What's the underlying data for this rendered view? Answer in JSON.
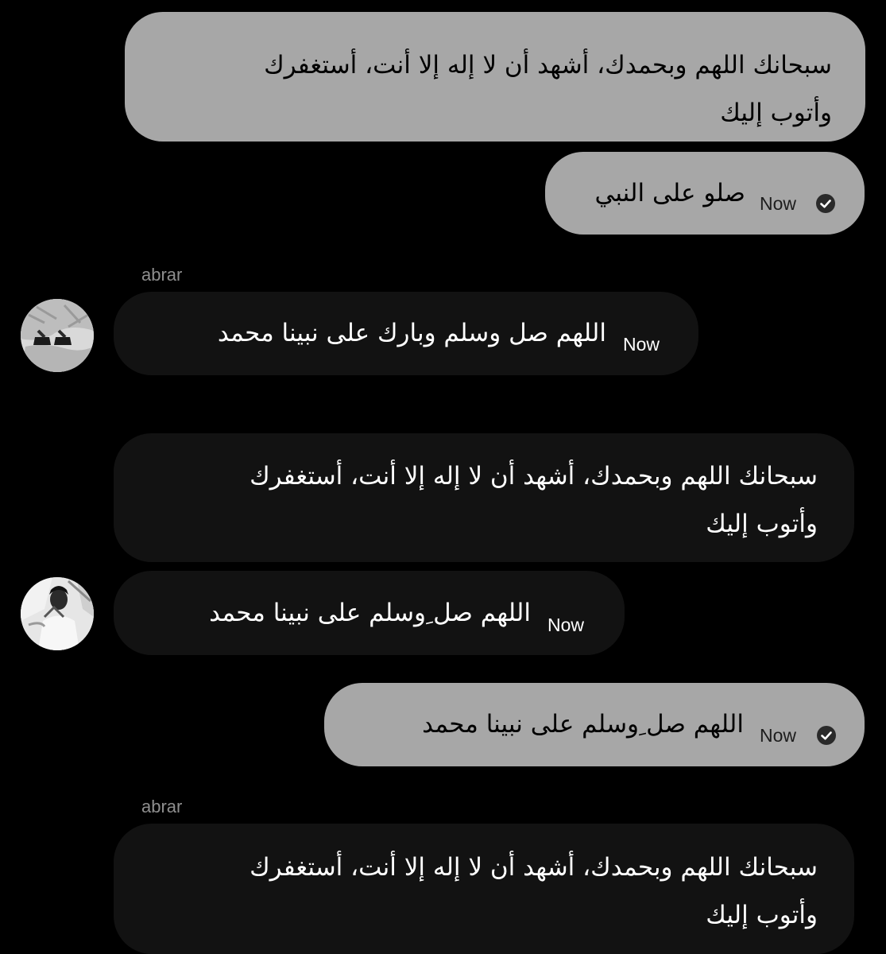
{
  "messages": [
    {
      "text": "سبحانك اللهم وبحمدك، أشهد أن لا إله إلا أنت، أستغفرك\nوأتوب إليك"
    },
    {
      "text": "صلو على النبي",
      "time": "Now"
    },
    {
      "sender": "abrar",
      "text": "اللهم صل وسلم وبارك على نبينا محمد",
      "time": "Now"
    },
    {
      "text": "سبحانك اللهم وبحمدك، أشهد أن لا إله إلا أنت، أستغفرك\nوأتوب إليك"
    },
    {
      "text": "اللهم صل ِوسلم على نبينا محمد",
      "time": "Now"
    },
    {
      "text": "اللهم صل ِوسلم على نبينا محمد",
      "time": "Now"
    },
    {
      "sender": "abrar",
      "text": "سبحانك اللهم وبحمدك، أشهد أن لا إله إلا أنت، أستغفرك\nوأتوب إليك"
    }
  ],
  "icons": {
    "read_receipt": "check-circle-icon",
    "avatar": "profile-avatar"
  },
  "colors": {
    "background": "#000000",
    "outgoing_bubble": "#a7a7a7",
    "incoming_bubble": "#121212",
    "sender_name": "#8e8e8e"
  }
}
